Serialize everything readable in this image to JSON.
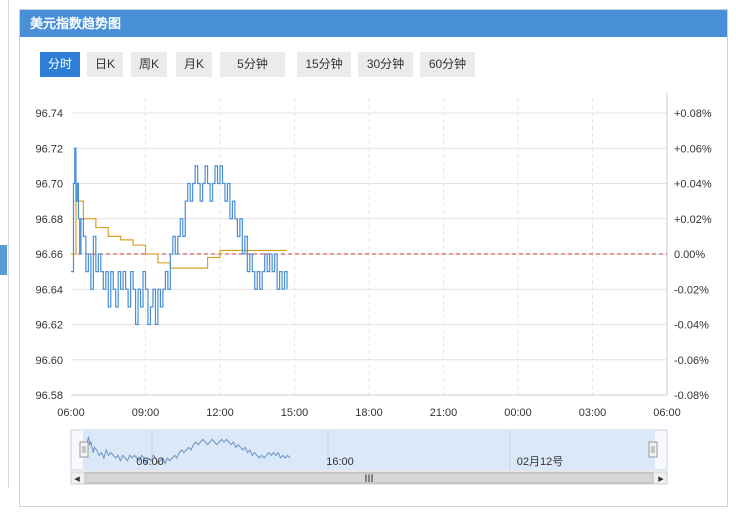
{
  "header": {
    "title": "美元指数趋势图"
  },
  "tabs": [
    {
      "label": "分时",
      "active": true
    },
    {
      "label": "日K",
      "active": false
    },
    {
      "label": "周K",
      "active": false
    },
    {
      "label": "月K",
      "active": false
    },
    {
      "label": "5分钟",
      "active": false
    },
    {
      "label": "15分钟",
      "active": false
    },
    {
      "label": "30分钟",
      "active": false
    },
    {
      "label": "60分钟",
      "active": false
    }
  ],
  "colors": {
    "header_bg": "#4a90d9",
    "active_tab": "#2f7ed8",
    "price_line": "#4a8fd6",
    "avg_line": "#d9a227",
    "base_line": "#cc3333",
    "positive_pct": "#cc3333",
    "negative_pct": "#339933"
  },
  "chart_data": {
    "type": "line",
    "x_tick_labels": [
      "06:00",
      "09:00",
      "12:00",
      "15:00",
      "18:00",
      "21:00",
      "00:00",
      "03:00",
      "06:00"
    ],
    "ylim": [
      96.58,
      96.74
    ],
    "y_tick_labels": [
      "96.74",
      "96.72",
      "96.70",
      "96.68",
      "96.66",
      "96.64",
      "96.62",
      "96.60",
      "96.58"
    ],
    "y2_tick_labels": [
      "+0.08%",
      "+0.06%",
      "+0.04%",
      "+0.02%",
      "0.00%",
      "-0.02%",
      "-0.04%",
      "-0.06%",
      "-0.08%"
    ],
    "base_value": 96.66,
    "grid": true,
    "series": [
      {
        "x": [
          0,
          0.1,
          0.15,
          0.2,
          0.25,
          0.3,
          0.35,
          0.4,
          0.5,
          0.6,
          0.7,
          0.8,
          0.9,
          1.0,
          1.1,
          1.2,
          1.3,
          1.4,
          1.5,
          1.6,
          1.7,
          1.8,
          1.9,
          2.0,
          2.1,
          2.2,
          2.3,
          2.4,
          2.5,
          2.6,
          2.7,
          2.8,
          2.9,
          3.0,
          3.1,
          3.2,
          3.3,
          3.4,
          3.5,
          3.6,
          3.7,
          3.8,
          3.9,
          4.0,
          4.1,
          4.2,
          4.3,
          4.4,
          4.5,
          4.6,
          4.7,
          4.8,
          4.9,
          5.0,
          5.1,
          5.2,
          5.3,
          5.4,
          5.5,
          5.6,
          5.7,
          5.8,
          5.9,
          6.0,
          6.1,
          6.2,
          6.3,
          6.4,
          6.5,
          6.6,
          6.7,
          6.8,
          6.9,
          7.0,
          7.1,
          7.2,
          7.3,
          7.4,
          7.5,
          7.6,
          7.7,
          7.8,
          7.9,
          8.0,
          8.1,
          8.2,
          8.3,
          8.4,
          8.5,
          8.6,
          8.7
        ],
        "values": [
          96.65,
          96.7,
          96.72,
          96.69,
          96.7,
          96.68,
          96.66,
          96.68,
          96.67,
          96.65,
          96.66,
          96.64,
          96.67,
          96.65,
          96.66,
          96.65,
          96.64,
          96.65,
          96.63,
          96.65,
          96.64,
          96.63,
          96.65,
          96.64,
          96.65,
          96.64,
          96.63,
          96.65,
          96.64,
          96.62,
          96.64,
          96.63,
          96.65,
          96.64,
          96.62,
          96.63,
          96.64,
          96.62,
          96.64,
          96.63,
          96.64,
          96.65,
          96.64,
          96.66,
          96.67,
          96.66,
          96.67,
          96.68,
          96.67,
          96.69,
          96.7,
          96.69,
          96.7,
          96.71,
          96.7,
          96.69,
          96.7,
          96.71,
          96.7,
          96.69,
          96.7,
          96.71,
          96.7,
          96.71,
          96.7,
          96.69,
          96.7,
          96.68,
          96.69,
          96.68,
          96.67,
          96.68,
          96.66,
          96.67,
          96.65,
          96.66,
          96.65,
          96.64,
          96.65,
          96.64,
          96.65,
          96.66,
          96.65,
          96.66,
          96.65,
          96.66,
          96.64,
          96.65,
          96.64,
          96.65,
          96.64
        ]
      },
      {
        "x": [
          0,
          0.2,
          0.5,
          1.0,
          1.5,
          2.0,
          2.5,
          3.0,
          3.5,
          4.0,
          4.5,
          5.0,
          5.5,
          6.0,
          6.5,
          7.0,
          7.5,
          8.0,
          8.7
        ],
        "values": [
          96.66,
          96.69,
          96.68,
          96.675,
          96.67,
          96.668,
          96.665,
          96.66,
          96.655,
          96.652,
          96.652,
          96.652,
          96.658,
          96.662,
          96.662,
          96.662,
          96.662,
          96.662,
          96.662
        ]
      }
    ]
  },
  "navigator": {
    "labels": [
      "06:00",
      "16:00",
      "02月12号"
    ],
    "scroll_grip": "III",
    "left_arrow": "◂",
    "right_arrow": "▸"
  }
}
